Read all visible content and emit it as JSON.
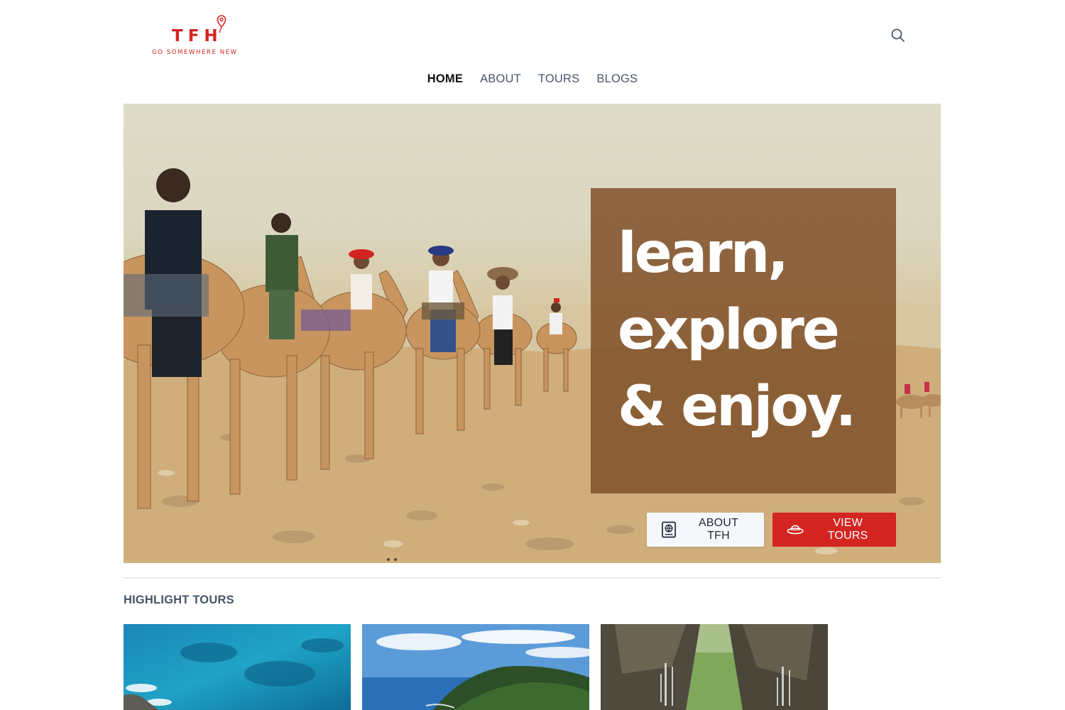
{
  "header": {
    "logo": {
      "letters": "TFH",
      "tagline": "GO SOMEWHERE NEW",
      "brand_color": "#d32521"
    },
    "search_icon": "search-icon"
  },
  "nav": {
    "items": [
      {
        "label": "HOME",
        "active": true
      },
      {
        "label": "ABOUT",
        "active": false
      },
      {
        "label": "TOURS",
        "active": false
      },
      {
        "label": "BLOGS",
        "active": false
      }
    ]
  },
  "hero": {
    "headline": [
      "learn,",
      "explore",
      "& enjoy."
    ],
    "buttons": {
      "about": {
        "label": "ABOUT TFH",
        "icon": "passport-icon"
      },
      "tours": {
        "label": "VIEW TOURS",
        "icon": "hat-icon",
        "color": "#d32521"
      }
    },
    "slide_count": 2
  },
  "highlights": {
    "title": "HIGHLIGHT TOURS",
    "cards": [
      {
        "image": "ocean-coast-image"
      },
      {
        "image": "green-headland-image"
      },
      {
        "image": "water-trough-image"
      }
    ]
  }
}
